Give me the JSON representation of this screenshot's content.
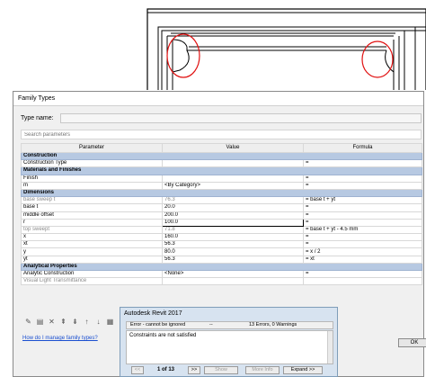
{
  "family_types": {
    "title": "Family Types",
    "type_name_label": "Type name:",
    "type_name_value": "",
    "search_placeholder": "Search parameters",
    "columns": {
      "parameter": "Parameter",
      "value": "Value",
      "formula": "Formula"
    },
    "rows": [
      {
        "kind": "group",
        "parameter": "Construction"
      },
      {
        "kind": "row",
        "parameter": "Construction Type",
        "value": "",
        "formula": "="
      },
      {
        "kind": "group",
        "parameter": "Materials and Finishes"
      },
      {
        "kind": "row",
        "parameter": "Finish",
        "value": "",
        "formula": "="
      },
      {
        "kind": "row",
        "parameter": "m",
        "value": "<By Category>",
        "formula": "="
      },
      {
        "kind": "group",
        "parameter": "Dimensions"
      },
      {
        "kind": "row",
        "parameter": "base sweep t",
        "value": "76.3",
        "formula": "= base t + yt",
        "grey": true
      },
      {
        "kind": "row",
        "parameter": "base t",
        "value": "20.0",
        "formula": "="
      },
      {
        "kind": "row",
        "parameter": "middle offset",
        "value": "200.0",
        "formula": "="
      },
      {
        "kind": "row",
        "parameter": "r",
        "value": "100.0",
        "formula": "=",
        "editing": true
      },
      {
        "kind": "row",
        "parameter": "top sweept",
        "value": "71.8",
        "formula": "= base t + yt - 4.5 mm",
        "grey": true
      },
      {
        "kind": "row",
        "parameter": "x",
        "value": "160.0",
        "formula": "="
      },
      {
        "kind": "row",
        "parameter": "xt",
        "value": "56.3",
        "formula": "="
      },
      {
        "kind": "row",
        "parameter": "y",
        "value": "80.0",
        "formula": "= x / 2"
      },
      {
        "kind": "row",
        "parameter": "yt",
        "value": "56.3",
        "formula": "= xt"
      },
      {
        "kind": "group",
        "parameter": "Analytical Properties"
      },
      {
        "kind": "row",
        "parameter": "Analytic Construction",
        "value": "<None>",
        "formula": "="
      },
      {
        "kind": "row",
        "parameter": "Visual Light Transmittance",
        "value": "",
        "formula": "",
        "grey": true
      }
    ],
    "toolbar_icons": [
      "pencil-icon",
      "new-parameter-icon",
      "delete-icon",
      "move-up-icon",
      "move-down-icon",
      "sort-ascending-icon",
      "sort-descending-icon",
      "manage-lookup-icon"
    ],
    "help_link": "How do I manage family types?",
    "ok_label": "OK"
  },
  "error_dialog": {
    "title": "Autodesk Revit 2017",
    "severity": "Error - cannot be ignored",
    "separator": "--",
    "counts": "13 Errors, 0 Warnings",
    "message": "Constraints are not satisfied",
    "first_label": "<<",
    "pager": "1 of 13",
    "next_label": ">>",
    "show_label": "Show",
    "more_info_label": "More Info",
    "expand_label": "Expand >>"
  },
  "colors": {
    "group_header": "#b7c9e2",
    "annotation_circle": "#e01010",
    "link": "#1a4fd0"
  }
}
